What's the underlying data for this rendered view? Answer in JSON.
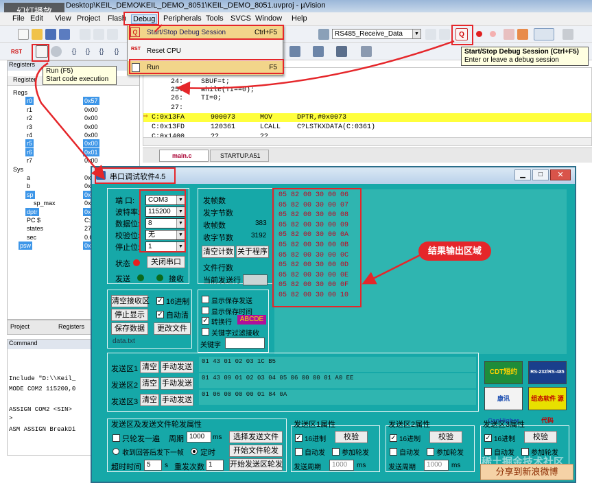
{
  "window": {
    "title_suffix": "Desktop\\KEIL_DEMO\\KEIL_DEMO_8051\\KEIL_DEMO_8051.uvproj - µVision",
    "slideshow_badge": "幻灯播放"
  },
  "menu": [
    "File",
    "Edit",
    "View",
    "Project",
    "Flash",
    "Debug",
    "Peripherals",
    "Tools",
    "SVCS",
    "Window",
    "Help"
  ],
  "toolbar": {
    "target_select": "RS485_Receive_Data"
  },
  "debug_menu": {
    "items": [
      {
        "label": "Start/Stop Debug Session",
        "shortcut": "Ctrl+F5"
      },
      {
        "label": "Reset CPU",
        "shortcut": ""
      },
      {
        "label": "Run",
        "shortcut": "F5"
      }
    ]
  },
  "tooltips": {
    "run_title": "Run (F5)",
    "run_desc": "Start code execution",
    "session_title": "Start/Stop Debug Session (Ctrl+F5)",
    "session_desc": "Enter or leave a debug session"
  },
  "registers": {
    "tab": "Registers",
    "header": "Register",
    "rows": [
      {
        "name": "Regs",
        "val": "",
        "indent": 0,
        "sel": false
      },
      {
        "name": "r0",
        "val": "0x57",
        "indent": 2,
        "sel": true
      },
      {
        "name": "r1",
        "val": "0x00",
        "indent": 2,
        "sel": false
      },
      {
        "name": "r2",
        "val": "0x00",
        "indent": 2,
        "sel": false
      },
      {
        "name": "r3",
        "val": "0x00",
        "indent": 2,
        "sel": false
      },
      {
        "name": "r4",
        "val": "0x00",
        "indent": 2,
        "sel": false
      },
      {
        "name": "r5",
        "val": "0x00",
        "indent": 2,
        "sel": true
      },
      {
        "name": "r6",
        "val": "0x01",
        "indent": 2,
        "sel": true
      },
      {
        "name": "r7",
        "val": "0x00",
        "indent": 2,
        "sel": false
      },
      {
        "name": "Sys",
        "val": "",
        "indent": 0,
        "sel": false
      },
      {
        "name": "a",
        "val": "0x0",
        "indent": 2,
        "sel": false
      },
      {
        "name": "b",
        "val": "0x0",
        "indent": 2,
        "sel": false
      },
      {
        "name": "sp",
        "val": "0x0",
        "indent": 2,
        "sel": true
      },
      {
        "name": "sp_max",
        "val": "0x0",
        "indent": 3,
        "sel": false
      },
      {
        "name": "dptr",
        "val": "0x1",
        "indent": 2,
        "sel": true
      },
      {
        "name": "PC  $",
        "val": "C:0",
        "indent": 2,
        "sel": false
      },
      {
        "name": "states",
        "val": "276",
        "indent": 2,
        "sel": false
      },
      {
        "name": "sec",
        "val": "0.0",
        "indent": 2,
        "sel": false
      },
      {
        "name": "psw",
        "val": "0x0",
        "indent": 1,
        "sel": true
      }
    ]
  },
  "code": {
    "lines": [
      {
        "num": "24:",
        "text": "SBUF=t;",
        "hl": false
      },
      {
        "num": "25:",
        "text": "while(TI==0);",
        "hl": false
      },
      {
        "num": "26:",
        "text": "TI=0;",
        "hl": false
      },
      {
        "num": "27:",
        "text": "",
        "hl": false
      },
      {
        "num": "C:0x13FA",
        "text": "900073      MOV      DPTR,#0x0073",
        "hl": true
      },
      {
        "num": "C:0x13FD",
        "text": "120361      LCALL    C?LSTKXDATA(C:0361)",
        "hl": false
      },
      {
        "num": "C:0x1400",
        "text": "??          ??",
        "hl": false
      }
    ],
    "tabs": [
      "main.c",
      "STARTUP.A51"
    ]
  },
  "project_tabs": [
    "Project",
    "Registers"
  ],
  "command": {
    "title": "Command",
    "lines": [
      "Include \"D:\\\\Keil_",
      "MODE COM2 115200,0",
      "",
      "ASSIGN COM2 <SIN>"
    ],
    "prompt": ">",
    "bottom": "ASM ASSIGN BreakDi"
  },
  "serial": {
    "title": "串口调试软件4.5",
    "port_labels": [
      "端  口:",
      "波特率:",
      "数据位:",
      "校验位:",
      "停止位:"
    ],
    "port_values": [
      "COM3",
      "115200",
      "8",
      "无",
      "1"
    ],
    "status_label": "状态",
    "close_port": "关闭串口",
    "send_led": "发送",
    "recv_led": "接收",
    "stats_labels": [
      "发帧数",
      "发字节数",
      "收帧数",
      "收字节数"
    ],
    "stats_values": [
      "",
      "",
      "383",
      "3192"
    ],
    "clear_count": "清空计数",
    "about": "关于程序",
    "file_line": "文件行数",
    "current_send": "当前发送行",
    "recv_btns": [
      "清空接收区",
      "停止显示",
      "保存数据"
    ],
    "hex_label": "16进制",
    "auto_clear": "自动清",
    "change_file": "更改文件",
    "file_name": "data.txt",
    "options": [
      "显示保存发送",
      "显示保存时间",
      "转换行",
      "关键字过滤接收"
    ],
    "option_checked": [
      false,
      false,
      true,
      false
    ],
    "newline_badge": "ABCDE",
    "keyword_label": "关键字",
    "output": [
      "05 82 00 30 00 06",
      "05 82 00 30 00 07",
      "05 82 00 30 00 08",
      "05 82 00 30 00 09",
      "05 82 00 30 00 0A",
      "05 82 00 30 00 0B",
      "05 82 00 30 00 0C",
      "05 82 00 30 00 0D",
      "05 82 00 30 00 0E",
      "05 82 00 30 00 0F",
      "05 82 00 30 00 10"
    ],
    "annotation": "结果输出区域",
    "send_areas": [
      {
        "label": "发送区1",
        "clear": "清空",
        "manual": "手动发送",
        "data": "01 43 01 02 03 1C B5"
      },
      {
        "label": "发送区2",
        "clear": "清空",
        "manual": "手动发送",
        "data": "01 43 09 01 02 03 04 05 06 00 00 01 A0 EE"
      },
      {
        "label": "发送区3",
        "clear": "清空",
        "manual": "手动发送",
        "data": "01 06 00 00 00 01 84 0A"
      }
    ],
    "poll": {
      "title": "发送区及发送文件轮发属性",
      "only_once": "只轮发一遍",
      "period_label": "周期",
      "period": "1000",
      "period_unit": "ms",
      "select_file": "选择发送文件",
      "recv_reply": "收到回答后发下一帧",
      "timed": "定时",
      "start_file": "开始文件轮发",
      "timeout_label": "超时时间",
      "timeout": "5",
      "timeout_unit": "s",
      "resend_label": "重发次数",
      "resend": "1",
      "start_area": "开始发送区轮发"
    },
    "areas": [
      {
        "title": "发送区1属性",
        "hex": "16进制",
        "checksum": "校验",
        "auto": "自动发",
        "join": "参加轮发",
        "cycle": "发送周期",
        "cycle_val": "1000",
        "unit": "ms"
      },
      {
        "title": "发送区2属性",
        "hex": "16进制",
        "checksum": "校验",
        "auto": "自动发",
        "join": "参加轮发",
        "cycle": "发送周期",
        "cycle_val": "1000",
        "unit": "ms"
      },
      {
        "title": "发送区3属性",
        "hex": "16进制",
        "checksum": "校验",
        "auto": "自动发",
        "join": "参加轮发"
      }
    ],
    "logos": [
      "CDT短约",
      "RS-232/RS-485",
      "康讯 CanHigher",
      "组态软件 源代码"
    ]
  },
  "watermark": "稀土掘金技术社区",
  "share": "分享到新浪微博",
  "colors": {
    "accent": "#e5262a",
    "serial_bg": "#16a8a8",
    "highlight": "#ffff3c"
  }
}
